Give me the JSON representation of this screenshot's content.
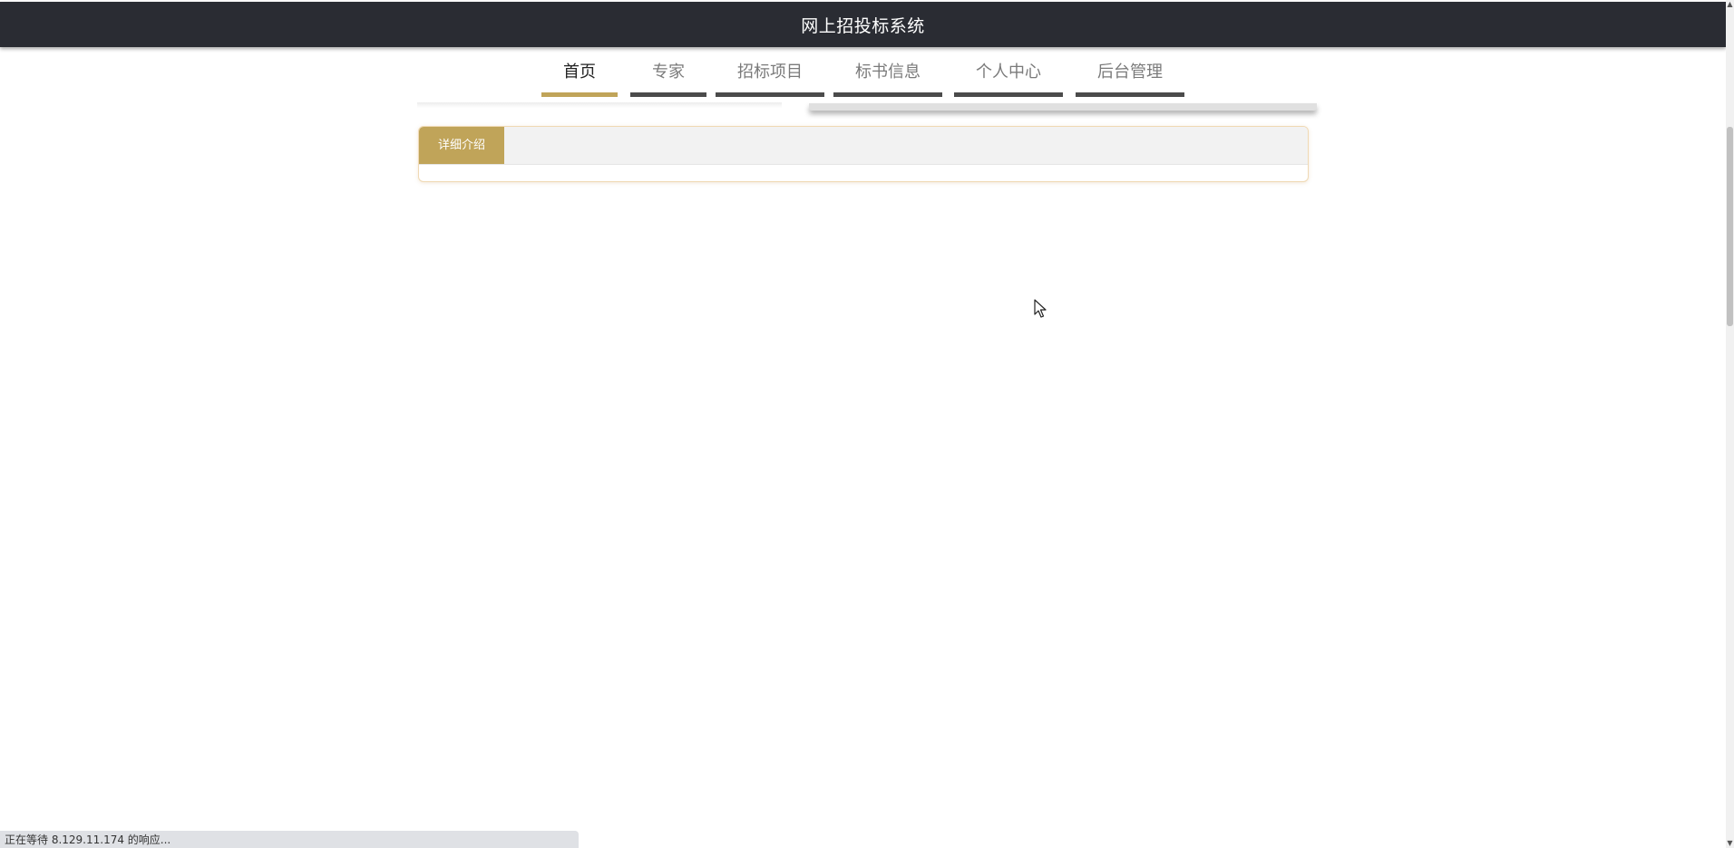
{
  "header": {
    "title": "网上招投标系统"
  },
  "nav": {
    "items": [
      {
        "label": "首页",
        "active": true
      },
      {
        "label": "专家",
        "active": false
      },
      {
        "label": "招标项目",
        "active": false
      },
      {
        "label": "标书信息",
        "active": false
      },
      {
        "label": "个人中心",
        "active": false
      },
      {
        "label": "后台管理",
        "active": false
      }
    ]
  },
  "detail_panel": {
    "tab_label": "详细介绍"
  },
  "status_bar": {
    "text": "正在等待 8.129.11.174 的响应..."
  },
  "colors": {
    "header_bg": "#2a2c33",
    "accent_gold": "#c0a459",
    "nav_underline": "#4b4b4b"
  },
  "icons": {
    "cursor": "mouse-pointer-icon",
    "scroll_up": "chevron-up-icon",
    "scroll_down": "chevron-down-icon"
  }
}
